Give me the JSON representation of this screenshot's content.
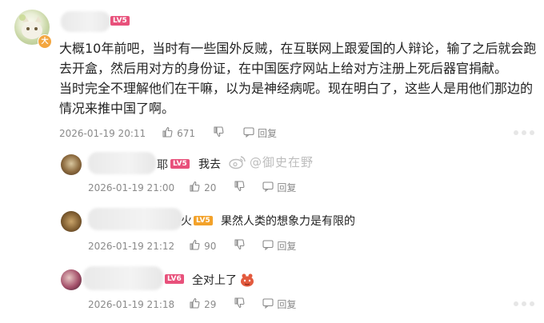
{
  "main_comment": {
    "level_badge": "LV5",
    "vip_badge": "大",
    "text_lines": [
      "大概10年前吧，当时有一些国外反贼，在互联网上跟爱国的人辩论，输了之后就会跑",
      "去开盒，然后用对方的身份证，在中国医疗网站上给对方注册上死后器官捐献。",
      "当时完全不理解他们在干嘛，以为是神经病呢。现在明白了，这些人是用他们那边的",
      "情况来推中国了啊。"
    ],
    "timestamp": "2026-01-19 20:11",
    "likes": "671",
    "reply_label": "回复"
  },
  "replies": [
    {
      "name_suffix": "耶",
      "level_badge": "LV5",
      "text": "我去",
      "timestamp": "2026-01-19 21:00",
      "likes": "20",
      "reply_label": "回复"
    },
    {
      "name_suffix": "火",
      "level_badge": "LV5",
      "text": "果然人类的想象力是有限的",
      "timestamp": "2026-01-19 21:12",
      "likes": "90",
      "reply_label": "回复"
    },
    {
      "name_suffix": "",
      "level_badge": "LV6",
      "text": "全对上了",
      "timestamp": "2026-01-19 21:18",
      "likes": "29",
      "reply_label": "回复"
    }
  ],
  "watermark": "@御史在野",
  "colors": {
    "level_red": "#e8517b",
    "level_orange": "#f3a22a",
    "meta_gray": "#8a8a8a"
  }
}
